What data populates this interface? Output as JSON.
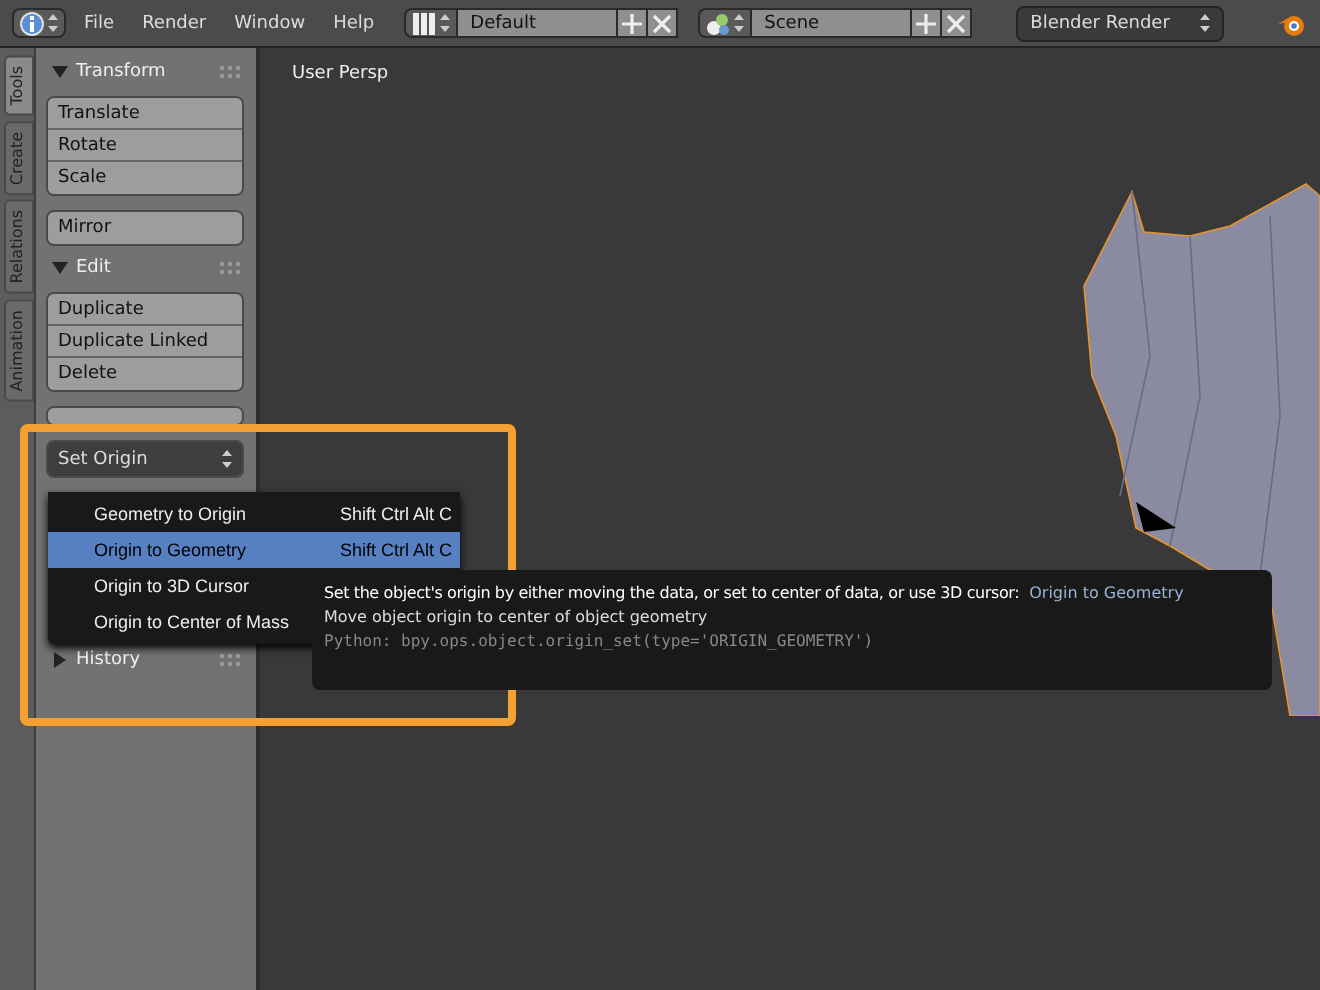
{
  "header": {
    "menus": [
      "File",
      "Render",
      "Window",
      "Help"
    ],
    "screen_layout": "Default",
    "scene": "Scene",
    "render_engine": "Blender Render"
  },
  "tool_tabs": [
    {
      "label": "Tools",
      "selected": true
    },
    {
      "label": "Create",
      "selected": false
    },
    {
      "label": "Relations",
      "selected": false
    },
    {
      "label": "Animation",
      "selected": false
    }
  ],
  "panels": [
    {
      "title": "Transform",
      "expanded": true,
      "groups": [
        [
          "Translate",
          "Rotate",
          "Scale"
        ],
        [
          "Mirror"
        ]
      ]
    },
    {
      "title": "Edit",
      "expanded": true,
      "groups": [
        [
          "Duplicate",
          "Duplicate Linked",
          "Delete"
        ]
      ]
    }
  ],
  "set_origin_dropdown": "Set Origin",
  "history_panel": {
    "title": "History",
    "expanded": false
  },
  "origin_menu": [
    {
      "label": "Geometry to Origin",
      "shortcut": "Shift Ctrl Alt C",
      "selected": false
    },
    {
      "label": "Origin to Geometry",
      "shortcut": "Shift Ctrl Alt C",
      "selected": true
    },
    {
      "label": "Origin to 3D Cursor",
      "selected": false
    },
    {
      "label": "Origin to Center of Mass",
      "selected": false
    }
  ],
  "tooltip": {
    "description": "Set the object's origin by either moving the data, or set to center of data, or use 3D cursor:",
    "operator": "Origin to Geometry",
    "detail": "Move object origin to center of object geometry",
    "python": "Python: bpy.ops.object.origin_set(type='ORIGIN_GEOMETRY')"
  },
  "viewport": {
    "label": "User Persp"
  }
}
